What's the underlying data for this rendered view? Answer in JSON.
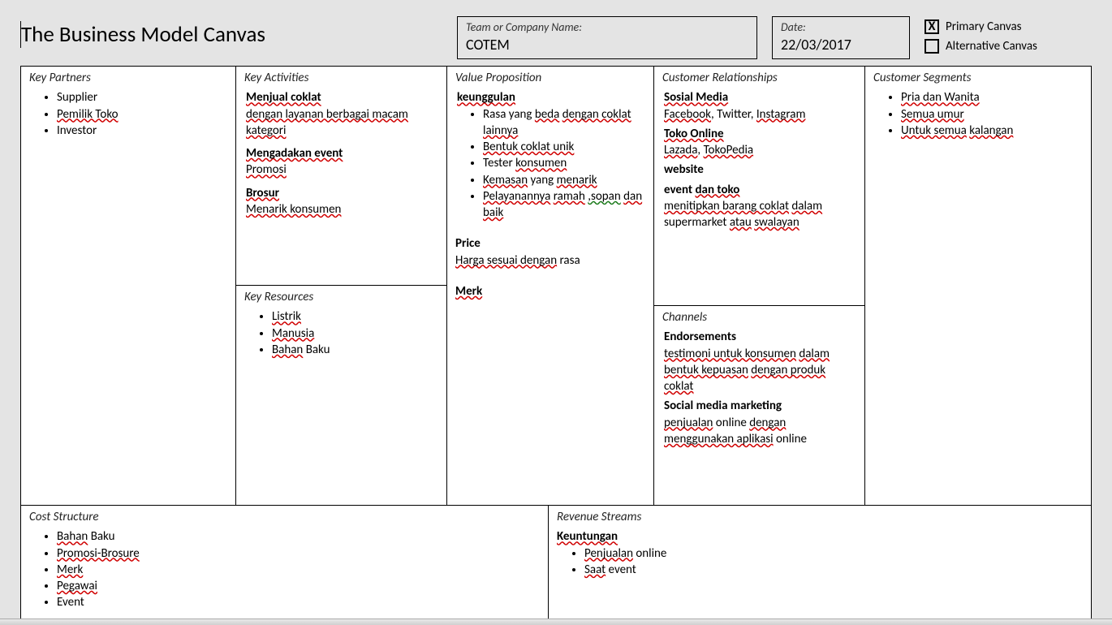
{
  "header": {
    "title": "The Business Model Canvas",
    "team_label": "Team or Company Name:",
    "team_value": "COTEM",
    "date_label": "Date:",
    "date_value": "22/03/2017",
    "primary_label": "Primary Canvas",
    "primary_mark": "X",
    "alt_label": "Alternative Canvas",
    "alt_mark": ""
  },
  "key_partners": {
    "title": "Key Partners",
    "items": [
      "Supplier",
      "Pemilik Toko",
      "Investor"
    ]
  },
  "key_activities": {
    "title": "Key Activities",
    "h1": "Menjual coklat",
    "d1": "dengan layanan berbagai macam kategori",
    "h2": "Mengadakan event",
    "d2": "Promosi",
    "h3": "Brosur",
    "d3": "Menarik konsumen"
  },
  "key_resources": {
    "title": "Key Resources",
    "items": [
      "Listrik",
      "Manusia",
      "Bahan Baku"
    ]
  },
  "value_proposition": {
    "title": "Value Proposition",
    "h1": "keunggulan",
    "bullets": [
      "Rasa yang beda dengan coklat lainnya",
      "Bentuk coklat unik",
      "Tester konsumen",
      "Kemasan yang menarik",
      "Pelayanannya ramah ,sopan dan baik"
    ],
    "h2": "Price",
    "d2": "Harga sesuai dengan rasa",
    "h3": "Merk"
  },
  "customer_relationships": {
    "title": "Customer Relationships",
    "h1": "Sosial Media",
    "d1": "Facebook, Twitter, Instagram",
    "h2": "Toko Online",
    "d2": "Lazada, TokoPedia",
    "h3": "website",
    "h4": "event dan toko",
    "d4": "menitipkan barang coklat dalam supermarket atau swalayan"
  },
  "channels": {
    "title": "Channels",
    "h1": "Endorsements",
    "d1": "testimoni untuk konsumen dalam bentuk kepuasan dengan produk coklat",
    "h2": "Social media marketing",
    "d2": "penjualan online dengan menggunakan aplikasi online"
  },
  "customer_segments": {
    "title": "Customer Segments",
    "items": [
      "Pria dan Wanita",
      "Semua umur",
      "Untuk semua kalangan"
    ]
  },
  "cost_structure": {
    "title": "Cost Structure",
    "items": [
      "Bahan Baku",
      "Promosi-Brosure",
      "Merk",
      "Pegawai",
      "Event"
    ]
  },
  "revenue_streams": {
    "title": "Revenue Streams",
    "h1": "Keuntungan",
    "items": [
      "Penjualan online",
      "Saat event"
    ]
  }
}
